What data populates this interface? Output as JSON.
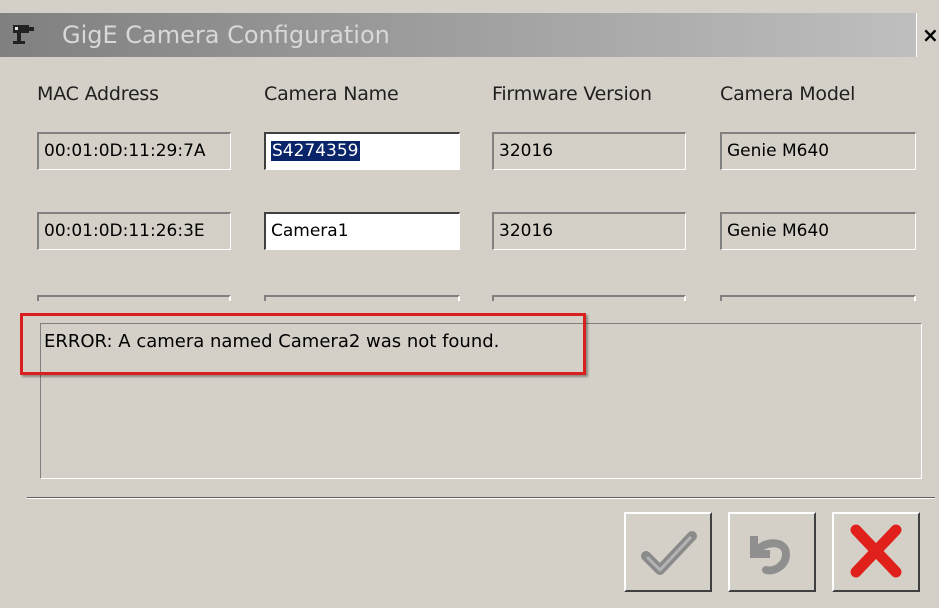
{
  "window": {
    "title": "GigE Camera Configuration",
    "close_glyph": "×"
  },
  "columns": [
    "MAC Address",
    "Camera Name",
    "Firmware Version",
    "Camera Model"
  ],
  "rows": [
    {
      "mac": "00:01:0D:11:29:7A",
      "name": "S4274359",
      "name_selected": true,
      "firmware": "32016",
      "model": "Genie M640"
    },
    {
      "mac": "00:01:0D:11:26:3E",
      "name": "Camera1",
      "name_selected": false,
      "firmware": "32016",
      "model": "Genie M640"
    }
  ],
  "message": {
    "text": "ERROR: A camera named Camera2 was not found.",
    "highlight_color": "#d9201e"
  },
  "buttons": [
    {
      "name": "ok-button",
      "icon": "checkmark-icon"
    },
    {
      "name": "undo-button",
      "icon": "undo-icon"
    },
    {
      "name": "cancel-button",
      "icon": "red-x-icon"
    }
  ],
  "colors": {
    "window_bg": "#d4d0c8",
    "selection_bg": "#0a246a",
    "cancel_red": "#e0201a"
  }
}
